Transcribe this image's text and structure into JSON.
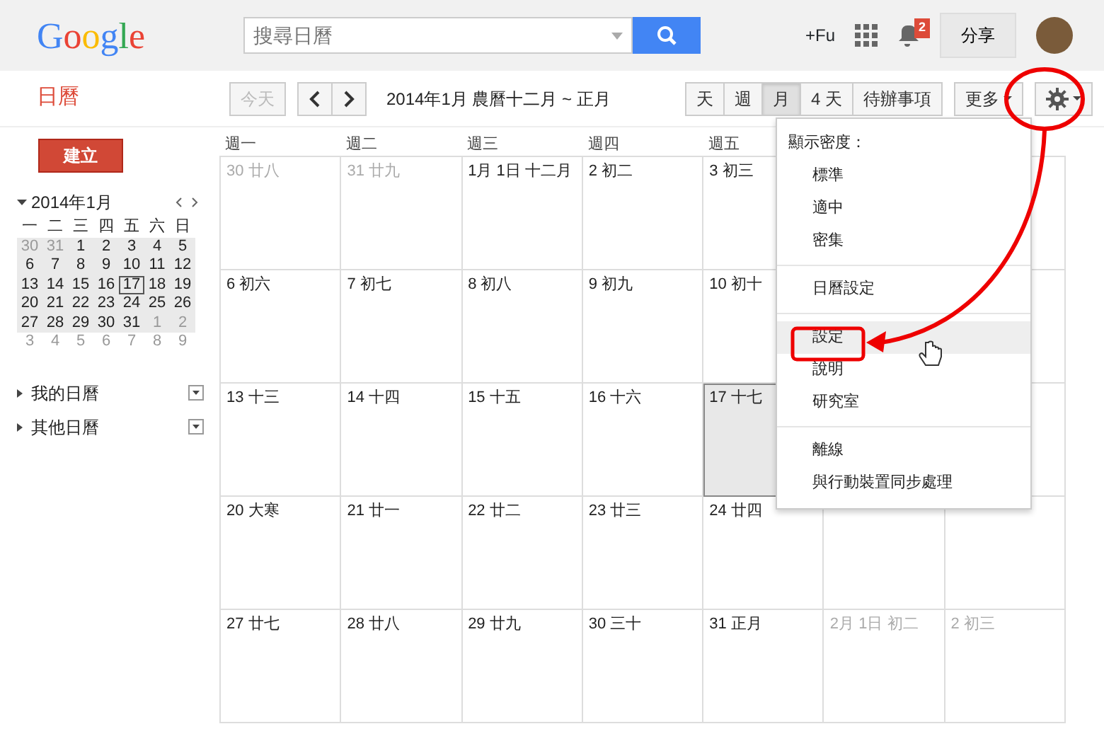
{
  "header": {
    "logo": "Google",
    "search": {
      "placeholder": "搜尋日曆"
    },
    "plus_label": "+Fu",
    "notifications": "2",
    "share_button": "分享"
  },
  "toolbar": {
    "app_title": "日曆",
    "today_button": {
      "label": "今天",
      "disabled": true
    },
    "date_range": "2014年1月 農曆十二月 ~ 正月",
    "views": [
      {
        "label": "天",
        "selected": false
      },
      {
        "label": "週",
        "selected": false
      },
      {
        "label": "月",
        "selected": true
      },
      {
        "label": "4 天",
        "selected": false
      },
      {
        "label": "待辦事項",
        "selected": false
      }
    ],
    "more_button": "更多"
  },
  "sidebar": {
    "create_button": "建立",
    "mini_calendar": {
      "title": "2014年1月",
      "weekdays": [
        "一",
        "二",
        "三",
        "四",
        "五",
        "六",
        "日"
      ],
      "weeks": [
        {
          "in_view": true,
          "days": [
            {
              "d": "30",
              "muted": true,
              "today": false
            },
            {
              "d": "31",
              "muted": true,
              "today": false
            },
            {
              "d": "1",
              "muted": false,
              "today": false
            },
            {
              "d": "2",
              "muted": false,
              "today": false
            },
            {
              "d": "3",
              "muted": false,
              "today": false
            },
            {
              "d": "4",
              "muted": false,
              "today": false
            },
            {
              "d": "5",
              "muted": false,
              "today": false
            }
          ]
        },
        {
          "in_view": true,
          "days": [
            {
              "d": "6",
              "muted": false,
              "today": false
            },
            {
              "d": "7",
              "muted": false,
              "today": false
            },
            {
              "d": "8",
              "muted": false,
              "today": false
            },
            {
              "d": "9",
              "muted": false,
              "today": false
            },
            {
              "d": "10",
              "muted": false,
              "today": false
            },
            {
              "d": "11",
              "muted": false,
              "today": false
            },
            {
              "d": "12",
              "muted": false,
              "today": false
            }
          ]
        },
        {
          "in_view": true,
          "days": [
            {
              "d": "13",
              "muted": false,
              "today": false
            },
            {
              "d": "14",
              "muted": false,
              "today": false
            },
            {
              "d": "15",
              "muted": false,
              "today": false
            },
            {
              "d": "16",
              "muted": false,
              "today": false
            },
            {
              "d": "17",
              "muted": false,
              "today": true
            },
            {
              "d": "18",
              "muted": false,
              "today": false
            },
            {
              "d": "19",
              "muted": false,
              "today": false
            }
          ]
        },
        {
          "in_view": true,
          "days": [
            {
              "d": "20",
              "muted": false,
              "today": false
            },
            {
              "d": "21",
              "muted": false,
              "today": false
            },
            {
              "d": "22",
              "muted": false,
              "today": false
            },
            {
              "d": "23",
              "muted": false,
              "today": false
            },
            {
              "d": "24",
              "muted": false,
              "today": false
            },
            {
              "d": "25",
              "muted": false,
              "today": false
            },
            {
              "d": "26",
              "muted": false,
              "today": false
            }
          ]
        },
        {
          "in_view": true,
          "days": [
            {
              "d": "27",
              "muted": false,
              "today": false
            },
            {
              "d": "28",
              "muted": false,
              "today": false
            },
            {
              "d": "29",
              "muted": false,
              "today": false
            },
            {
              "d": "30",
              "muted": false,
              "today": false
            },
            {
              "d": "31",
              "muted": false,
              "today": false
            },
            {
              "d": "1",
              "muted": true,
              "today": false
            },
            {
              "d": "2",
              "muted": true,
              "today": false
            }
          ]
        },
        {
          "in_view": false,
          "days": [
            {
              "d": "3",
              "muted": true,
              "today": false
            },
            {
              "d": "4",
              "muted": true,
              "today": false
            },
            {
              "d": "5",
              "muted": true,
              "today": false
            },
            {
              "d": "6",
              "muted": true,
              "today": false
            },
            {
              "d": "7",
              "muted": true,
              "today": false
            },
            {
              "d": "8",
              "muted": true,
              "today": false
            },
            {
              "d": "9",
              "muted": true,
              "today": false
            }
          ]
        }
      ]
    },
    "calendar_lists": [
      {
        "label": "我的日曆",
        "expanded": false
      },
      {
        "label": "其他日曆",
        "expanded": false
      }
    ]
  },
  "month_grid": {
    "weekdays": [
      "週一",
      "週二",
      "週三",
      "週四",
      "週五"
    ],
    "weeks": [
      [
        {
          "text": "30 廿八",
          "muted": true,
          "today": false
        },
        {
          "text": "31 廿九",
          "muted": true,
          "today": false
        },
        {
          "text": "1月 1日 十二月",
          "muted": false,
          "today": false
        },
        {
          "text": "2 初二",
          "muted": false,
          "today": false
        },
        {
          "text": "3 初三",
          "muted": false,
          "today": false
        }
      ],
      [
        {
          "text": "6 初六",
          "muted": false,
          "today": false
        },
        {
          "text": "7 初七",
          "muted": false,
          "today": false
        },
        {
          "text": "8 初八",
          "muted": false,
          "today": false
        },
        {
          "text": "9 初九",
          "muted": false,
          "today": false
        },
        {
          "text": "10 初十",
          "muted": false,
          "today": false
        }
      ],
      [
        {
          "text": "13 十三",
          "muted": false,
          "today": false
        },
        {
          "text": "14 十四",
          "muted": false,
          "today": false
        },
        {
          "text": "15 十五",
          "muted": false,
          "today": false
        },
        {
          "text": "16 十六",
          "muted": false,
          "today": false
        },
        {
          "text": "17 十七",
          "muted": false,
          "today": true
        }
      ],
      [
        {
          "text": "20 大寒",
          "muted": false,
          "today": false
        },
        {
          "text": "21 廿一",
          "muted": false,
          "today": false
        },
        {
          "text": "22 廿二",
          "muted": false,
          "today": false
        },
        {
          "text": "23 廿三",
          "muted": false,
          "today": false
        },
        {
          "text": "24 廿四",
          "muted": false,
          "today": false
        }
      ],
      [
        {
          "text": "27 廿七",
          "muted": false,
          "today": false
        },
        {
          "text": "28 廿八",
          "muted": false,
          "today": false
        },
        {
          "text": "29 廿九",
          "muted": false,
          "today": false
        },
        {
          "text": "30 三十",
          "muted": false,
          "today": false
        },
        {
          "text": "31 正月",
          "muted": false,
          "today": false
        },
        {
          "text": "2月 1日 初二",
          "muted": true,
          "today": false
        },
        {
          "text": "2 初三",
          "muted": true,
          "today": false
        }
      ]
    ]
  },
  "settings_menu": {
    "sections": [
      {
        "heading": "顯示密度：",
        "items": [
          {
            "label": "標準",
            "highlighted": false
          },
          {
            "label": "適中",
            "highlighted": false
          },
          {
            "label": "密集",
            "highlighted": false
          }
        ]
      },
      {
        "items": [
          {
            "label": "日曆設定",
            "highlighted": false
          }
        ]
      },
      {
        "items": [
          {
            "label": "設定",
            "highlighted": true
          },
          {
            "label": "說明",
            "highlighted": false
          },
          {
            "label": "研究室",
            "highlighted": false
          }
        ]
      },
      {
        "items": [
          {
            "label": "離線",
            "highlighted": false
          },
          {
            "label": "與行動裝置同步處理",
            "highlighted": false
          }
        ]
      }
    ]
  }
}
